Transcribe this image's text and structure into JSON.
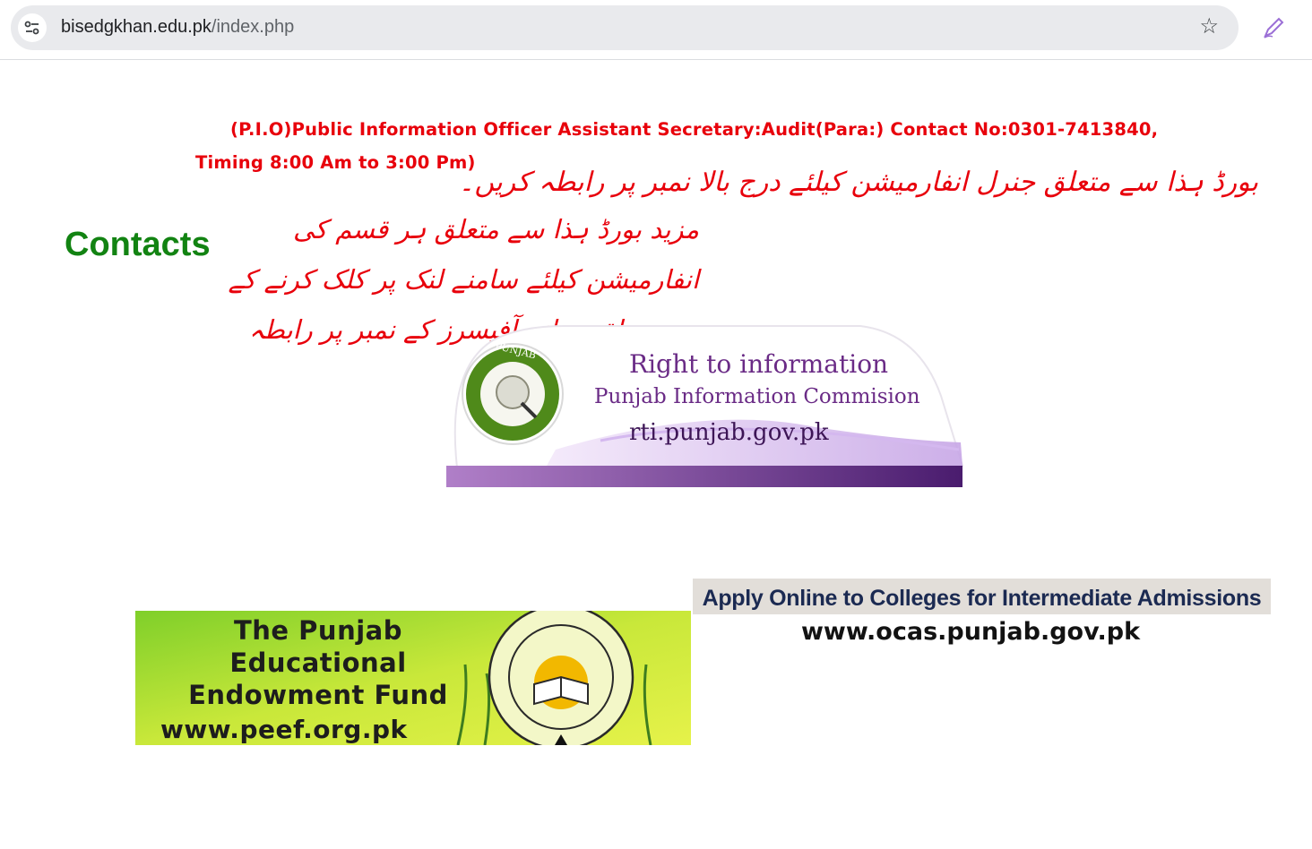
{
  "browser": {
    "url_host": "bisedgkhan.edu.pk",
    "url_path": "/index.php",
    "site_info_icon": "tune-icon",
    "bookmark_icon": "star-icon",
    "extension_icon": "pen-icon"
  },
  "pio": {
    "line1": "(P.I.O)Public Information Officer Assistant Secretary:Audit(Para:) Contact No:0301-7413840,",
    "line2": "Timing 8:00 Am to 3:00 Pm)"
  },
  "urdu": {
    "general_info": "بورڈ ہذا سے متعلق جنرل انفارمیشن کیلئے درج بالا نمبر پر رابطہ کریں۔",
    "more_info": "مزید بورڈ ہذا سے متعلق ہر قسم کی انفارمیشن کیلئے سامنے لنک پر کلک کرنے کے بعد متعلقہ برانچ آفیسرز کے نمبر پر رابطہ کریں۔"
  },
  "contacts": {
    "title": "Contacts"
  },
  "rti": {
    "seal_text": "PUNJAB",
    "title": "Right to information",
    "subtitle": "Punjab Information Commision",
    "url": "rti.punjab.gov.pk"
  },
  "peef": {
    "title_line1": "The Punjab Educational",
    "title_line2": "Endowment Fund",
    "url": "www.peef.org.pk"
  },
  "ocas": {
    "line1": "Apply Online to Colleges for Intermediate Admissions",
    "line2": "www.ocas.punjab.gov.pk"
  },
  "colors": {
    "red_text": "#e8000b",
    "contacts_green": "#128312",
    "rti_purple": "#6a2b86"
  }
}
